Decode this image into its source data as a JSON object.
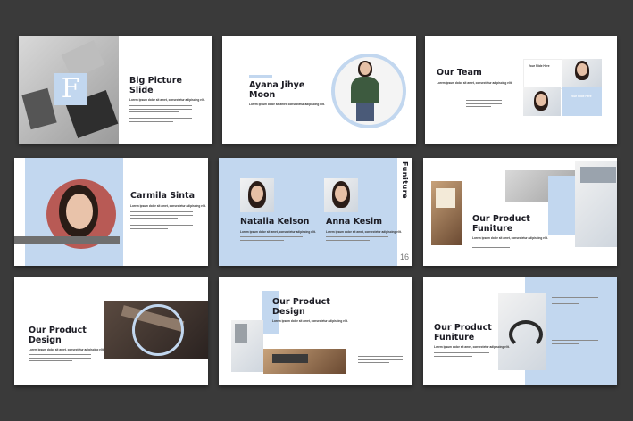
{
  "slides": {
    "s1": {
      "title_line1": "Big Picture",
      "title_line2": "Slide",
      "logo_letter": "F",
      "subtitle": "Lorem ipsum dolor sit amet, consectetur adipiscing elit."
    },
    "s2": {
      "title_line1": "Ayana Jihye",
      "title_line2": "Moon",
      "subtitle": "Lorem ipsum dolor sit amet, consectetur adipiscing elit."
    },
    "s3": {
      "title": "Our Team",
      "subtitle": "Lorem ipsum dolor sit amet, consectetur adipiscing elit.",
      "card1_label": "Your Slide Here",
      "card2_label": "Your Slide Here"
    },
    "s4": {
      "title": "Carmila Sinta",
      "subtitle": "Lorem ipsum dolor sit amet, consectetur adipiscing elit."
    },
    "s5": {
      "name1": "Natalia Kelson",
      "name2": "Anna Kesim",
      "subtitle1": "Lorem ipsum dolor sit amet, consectetur adipiscing elit.",
      "subtitle2": "Lorem ipsum dolor sit amet, consectetur adipiscing elit.",
      "vertical_label": "Funiture",
      "page_number": "16"
    },
    "s6": {
      "title_line1": "Our Product",
      "title_line2": "Funiture",
      "subtitle": "Lorem ipsum dolor sit amet, consectetur adipiscing elit."
    },
    "s7": {
      "title_line1": "Our Product",
      "title_line2": "Design",
      "subtitle": "Lorem ipsum dolor sit amet, consectetur adipiscing elit."
    },
    "s8": {
      "title_line1": "Our Product",
      "title_line2": "Design",
      "subtitle": "Lorem ipsum dolor sit amet, consectetur adipiscing elit."
    },
    "s9": {
      "title_line1": "Our Product",
      "title_line2": "Funiture",
      "subtitle": "Lorem ipsum dolor sit amet, consectetur adipiscing elit."
    }
  },
  "colors": {
    "background": "#3a3a3a",
    "accent_blue": "#c2d7ef",
    "slide": "#ffffff",
    "text": "#1c1c24"
  }
}
